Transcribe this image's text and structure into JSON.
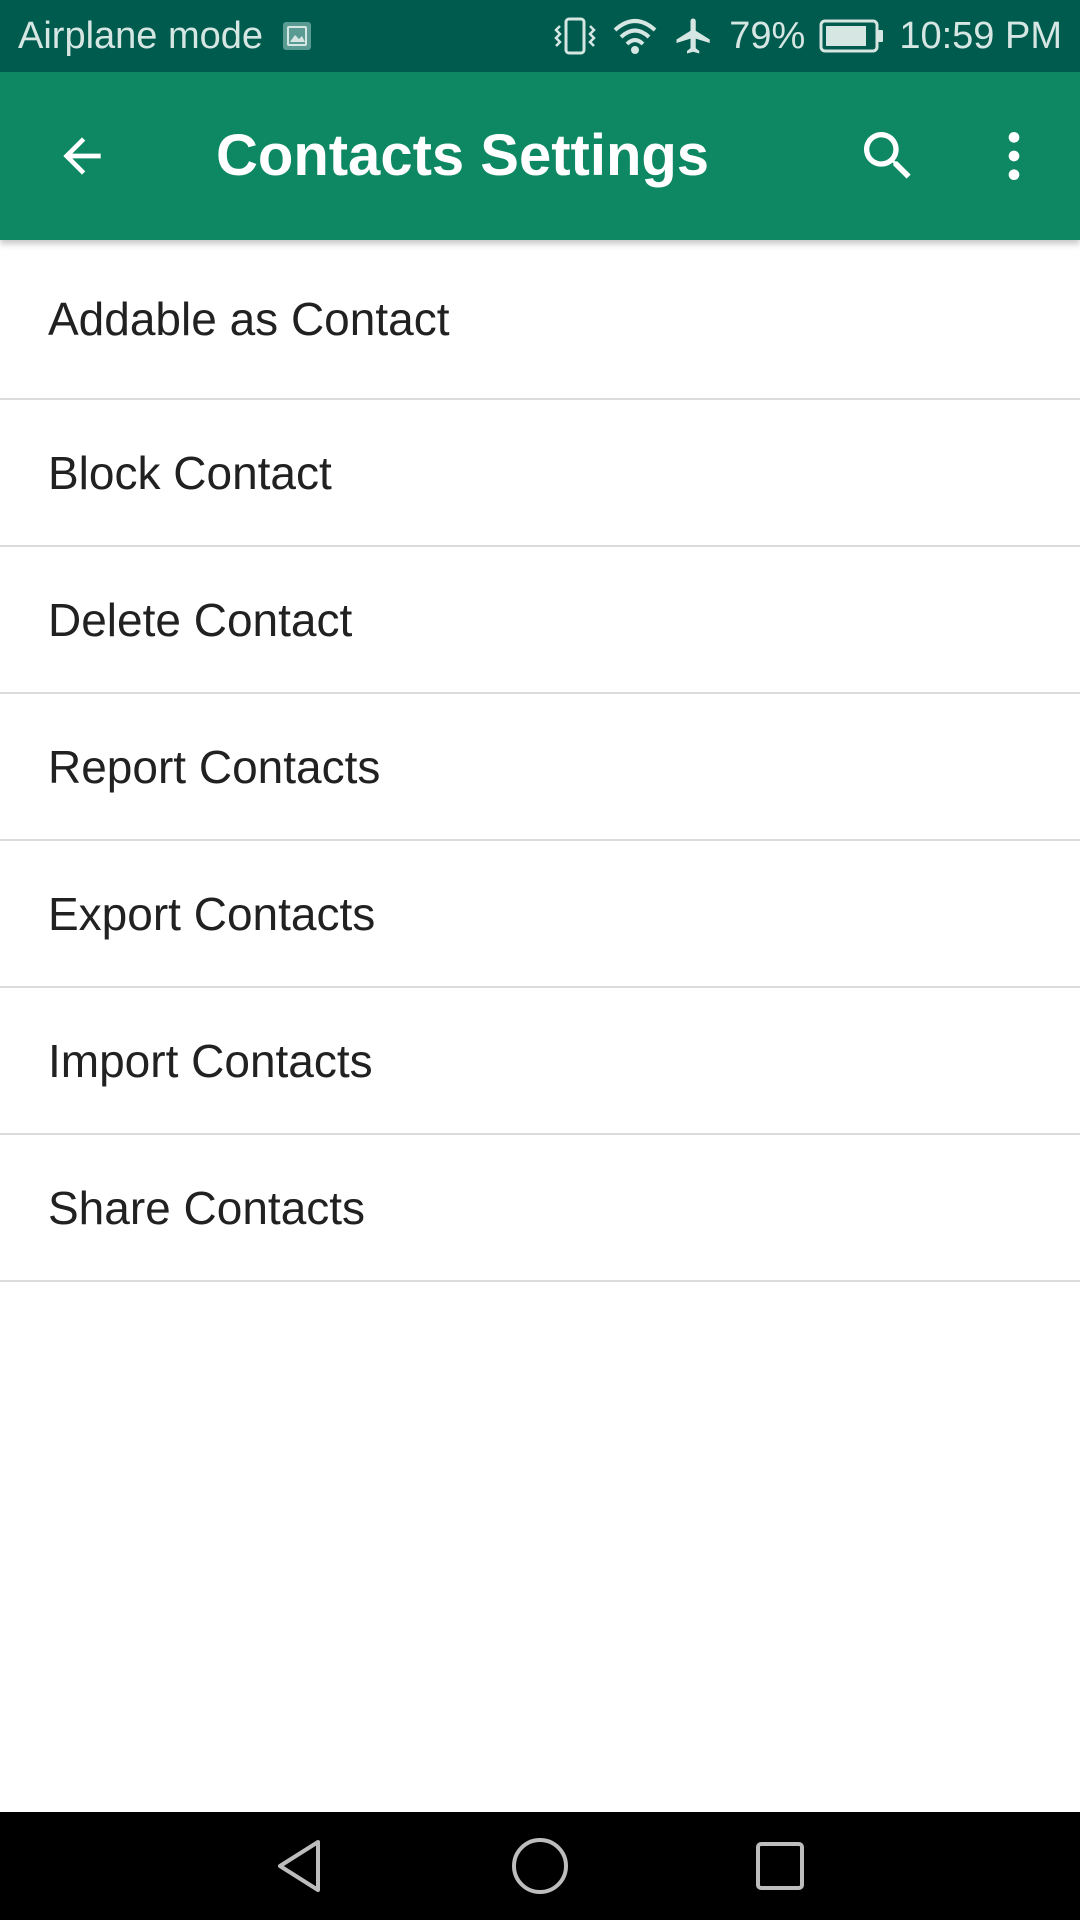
{
  "status_bar": {
    "left_text": "Airplane mode",
    "battery_percent": "79%",
    "time": "10:59 PM",
    "icons": [
      "image-notification-icon",
      "vibrate-icon",
      "wifi-icon",
      "airplane-icon",
      "battery-icon"
    ]
  },
  "app_bar": {
    "title": "Contacts Settings",
    "color": "#0e8862",
    "icons": [
      "back-arrow-icon",
      "search-icon",
      "more-vert-icon"
    ]
  },
  "settings": {
    "items": [
      {
        "label": "Addable as Contact"
      },
      {
        "label": "Block Contact"
      },
      {
        "label": "Delete Contact"
      },
      {
        "label": "Report Contacts"
      },
      {
        "label": "Export Contacts"
      },
      {
        "label": "Import Contacts"
      },
      {
        "label": "Share Contacts"
      }
    ]
  },
  "nav_bar": {
    "icons": [
      "nav-back-icon",
      "nav-home-icon",
      "nav-recent-icon"
    ]
  },
  "colors": {
    "status_bar": "#005b4f",
    "app_bar": "#0e8862",
    "divider": "#dcdcdc",
    "text": "#212121"
  }
}
